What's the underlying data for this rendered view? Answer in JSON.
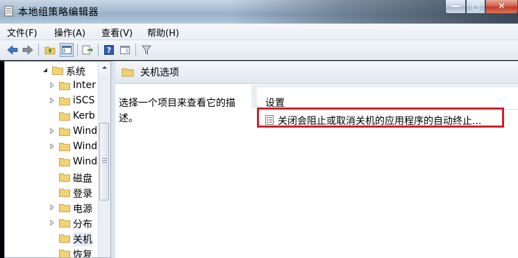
{
  "window": {
    "title": "本地组策略编辑器"
  },
  "caption_buttons": {
    "min": "—",
    "max": "▢",
    "close": "✕"
  },
  "menu": [
    {
      "label": "文件(F)"
    },
    {
      "label": "操作(A)"
    },
    {
      "label": "查看(V)"
    },
    {
      "label": "帮助(H)"
    }
  ],
  "toolbar": {
    "icons": [
      "back-arrow-icon",
      "forward-arrow-icon",
      "up-folder-icon",
      "show-hide-tree-icon",
      "export-list-icon",
      "help-icon",
      "properties-pane-icon",
      "filter-icon"
    ]
  },
  "tree": {
    "items": [
      {
        "label": "系统",
        "expanded": true
      },
      {
        "label": "Inter",
        "expandable": true
      },
      {
        "label": "iSCS",
        "expandable": true
      },
      {
        "label": "Kerb",
        "expandable": false
      },
      {
        "label": "Wind",
        "expandable": true
      },
      {
        "label": "Wind",
        "expandable": true
      },
      {
        "label": "Wind",
        "expandable": false
      },
      {
        "label": "磁盘",
        "expandable": false
      },
      {
        "label": "登录",
        "expandable": false
      },
      {
        "label": "电源",
        "expandable": true
      },
      {
        "label": "分布",
        "expandable": true
      },
      {
        "label": "关机",
        "expandable": false,
        "selected": true
      },
      {
        "label": "恢复",
        "expandable": false
      }
    ]
  },
  "main": {
    "folder_title": "关机选项",
    "description": "选择一个项目来查看它的描述。",
    "column_header": "设置",
    "policies": [
      {
        "label": "关闭会阻止或取消关机的应用程序的自动终止..."
      }
    ]
  },
  "colors": {
    "highlight_border": "#cc1f2b",
    "folder_yellow": "#f2d374"
  }
}
